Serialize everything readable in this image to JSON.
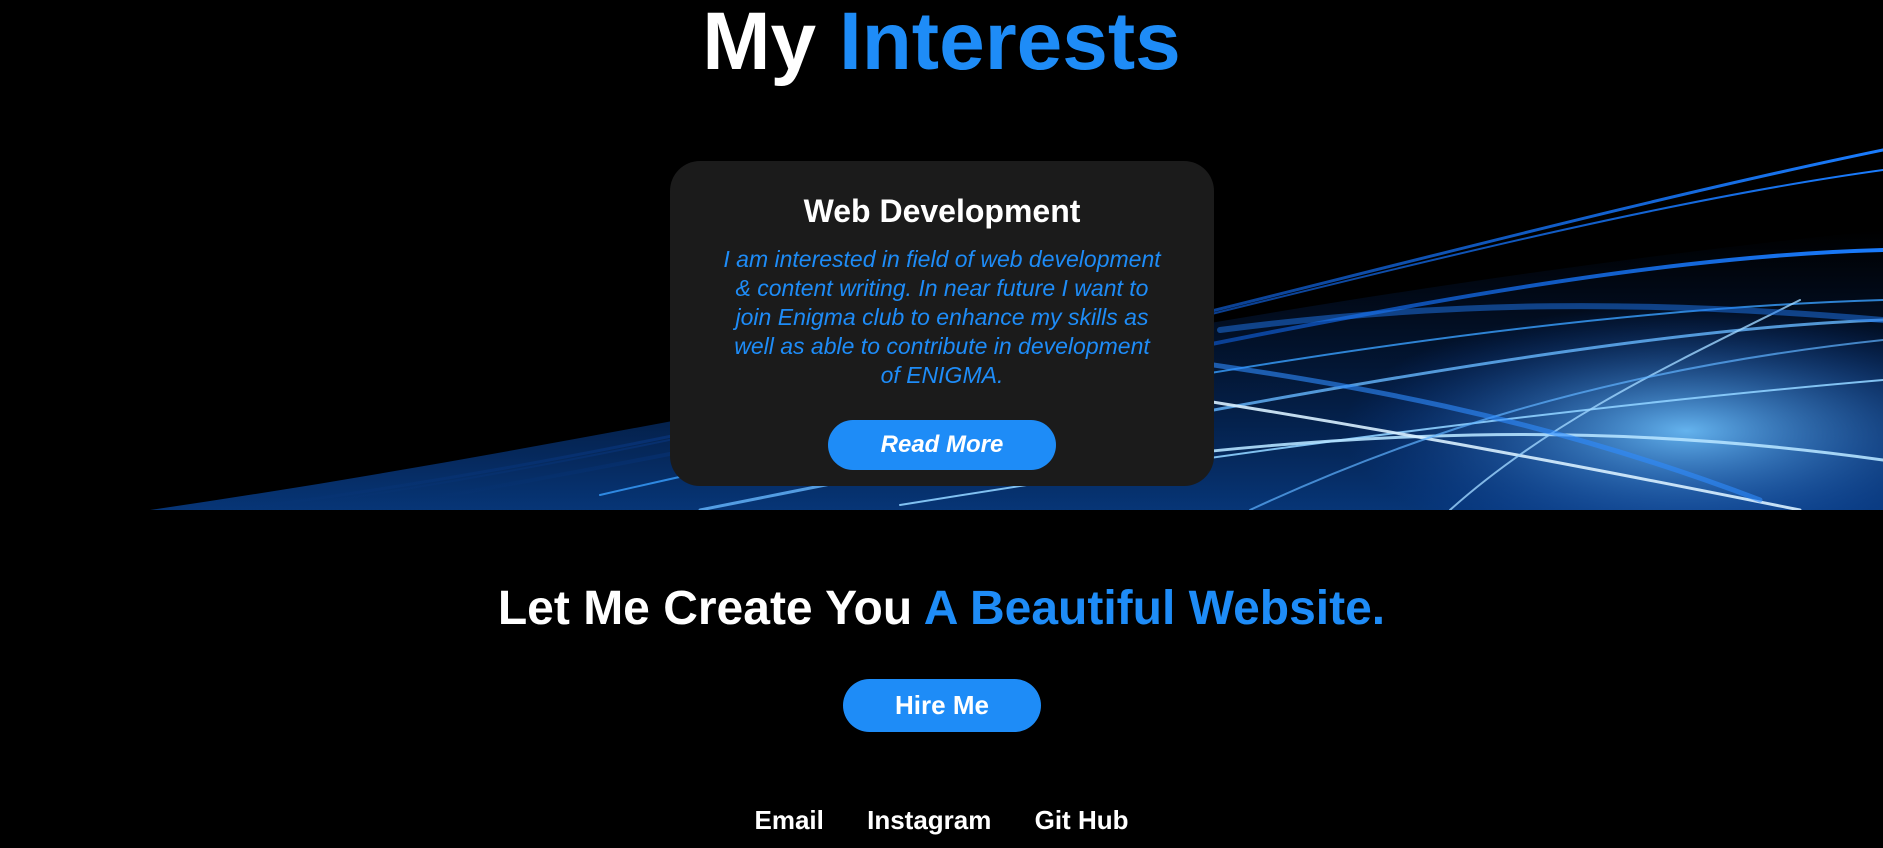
{
  "interests": {
    "title_part1": "My",
    "title_part2": "Interests",
    "card": {
      "title": "Web Development",
      "text": "I am interested in field of web development & content writing. In near future I want to join Enigma club to enhance my skills as well as able to contribute in development of ENIGMA.",
      "button_label": "Read More"
    }
  },
  "cta": {
    "title_part1": "Let Me Create You",
    "title_part2": "A Beautiful Website.",
    "button_label": "Hire Me"
  },
  "footer": {
    "links": [
      "Email",
      "Instagram",
      "Git Hub"
    ]
  },
  "colors": {
    "accent": "#1e8cf7",
    "background": "#000000",
    "card": "#1b1b1b"
  }
}
